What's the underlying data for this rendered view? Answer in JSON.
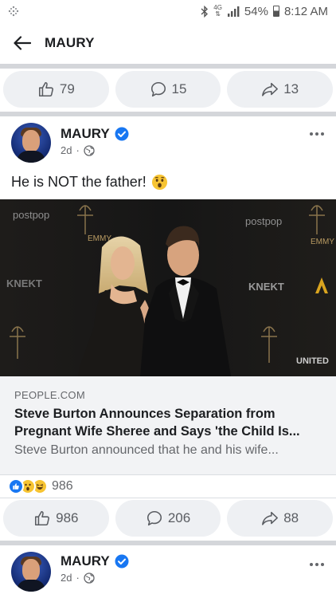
{
  "status_bar": {
    "network": "4G",
    "battery": "54%",
    "time": "8:12 AM"
  },
  "header": {
    "title": "MAURY"
  },
  "previous_post": {
    "like_count": "79",
    "comment_count": "15",
    "share_count": "13"
  },
  "post": {
    "author": "MAURY",
    "verified": true,
    "time": "2d",
    "privacy_icon": "globe-icon",
    "text": "He is NOT the father!",
    "emoji": "😲",
    "link_preview": {
      "domain": "PEOPLE.COM",
      "headline": "Steve Burton Announces Separation from Pregnant Wife Sheree and Says 'the Child Is...",
      "description": "Steve Burton announced that he and his wife...",
      "image_signage": {
        "brand_1": "postpop",
        "brand_2": "KNEKT",
        "award": "EMMY",
        "network": "UNITED"
      }
    },
    "reactions": {
      "types": [
        "like",
        "wow",
        "haha"
      ],
      "total": "986"
    },
    "like_count": "986",
    "comment_count": "206",
    "share_count": "88"
  },
  "next_post": {
    "author": "MAURY",
    "verified": true,
    "time": "2d",
    "privacy_icon": "globe-icon"
  },
  "colors": {
    "facebook_blue": "#1877f2",
    "pill_bg": "#eef0f3",
    "separator": "#c9ccd1",
    "secondary_text": "#65676b",
    "link_box_bg": "#f2f3f5"
  }
}
